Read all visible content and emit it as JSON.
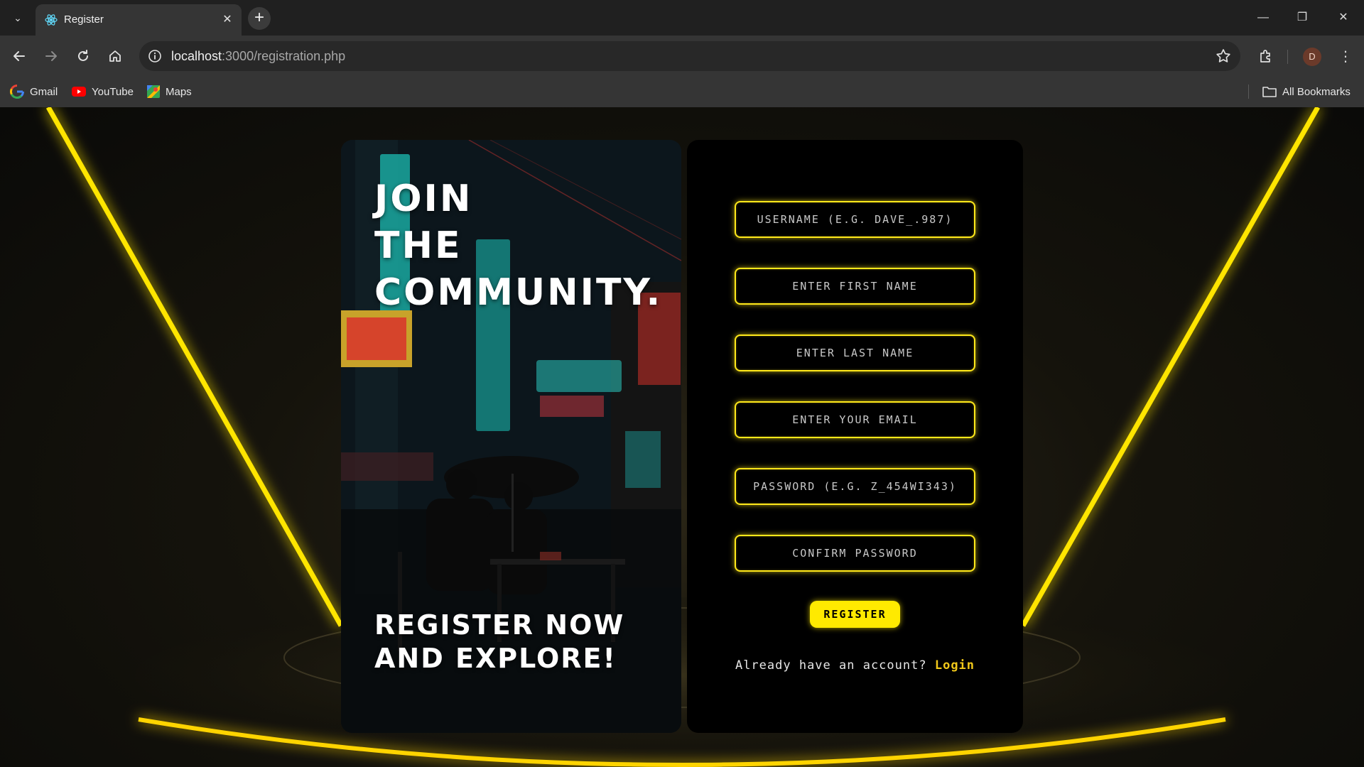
{
  "browser": {
    "tab_title": "Register",
    "url_host": "localhost",
    "url_rest": ":3000/registration.php",
    "avatar_initial": "D",
    "bookmarks": [
      {
        "label": "Gmail",
        "icon": "gmail-icon"
      },
      {
        "label": "YouTube",
        "icon": "youtube-icon"
      },
      {
        "label": "Maps",
        "icon": "maps-icon"
      }
    ],
    "all_bookmarks_label": "All Bookmarks"
  },
  "hero": {
    "title_lines": [
      "JOIN",
      "THE",
      "COMMUNITY."
    ],
    "subtitle_lines": [
      "REGISTER NOW",
      "AND EXPLORE!"
    ]
  },
  "form": {
    "fields": [
      {
        "placeholder": "USERNAME (E.G. DAVE_.987)",
        "value": ""
      },
      {
        "placeholder": "ENTER FIRST NAME",
        "value": ""
      },
      {
        "placeholder": "ENTER LAST NAME",
        "value": ""
      },
      {
        "placeholder": "ENTER YOUR EMAIL",
        "value": ""
      },
      {
        "placeholder": "PASSWORD (E.G. Z_454wi343)",
        "value": ""
      },
      {
        "placeholder": "CONFIRM PASSWORD",
        "value": ""
      }
    ],
    "register_label": "REGISTER",
    "login_prompt": "Already have an account?",
    "login_link": "Login"
  },
  "colors": {
    "accent": "#ffea00",
    "link": "#f2c91a",
    "chrome": "#353535",
    "tabbar": "#202020"
  }
}
